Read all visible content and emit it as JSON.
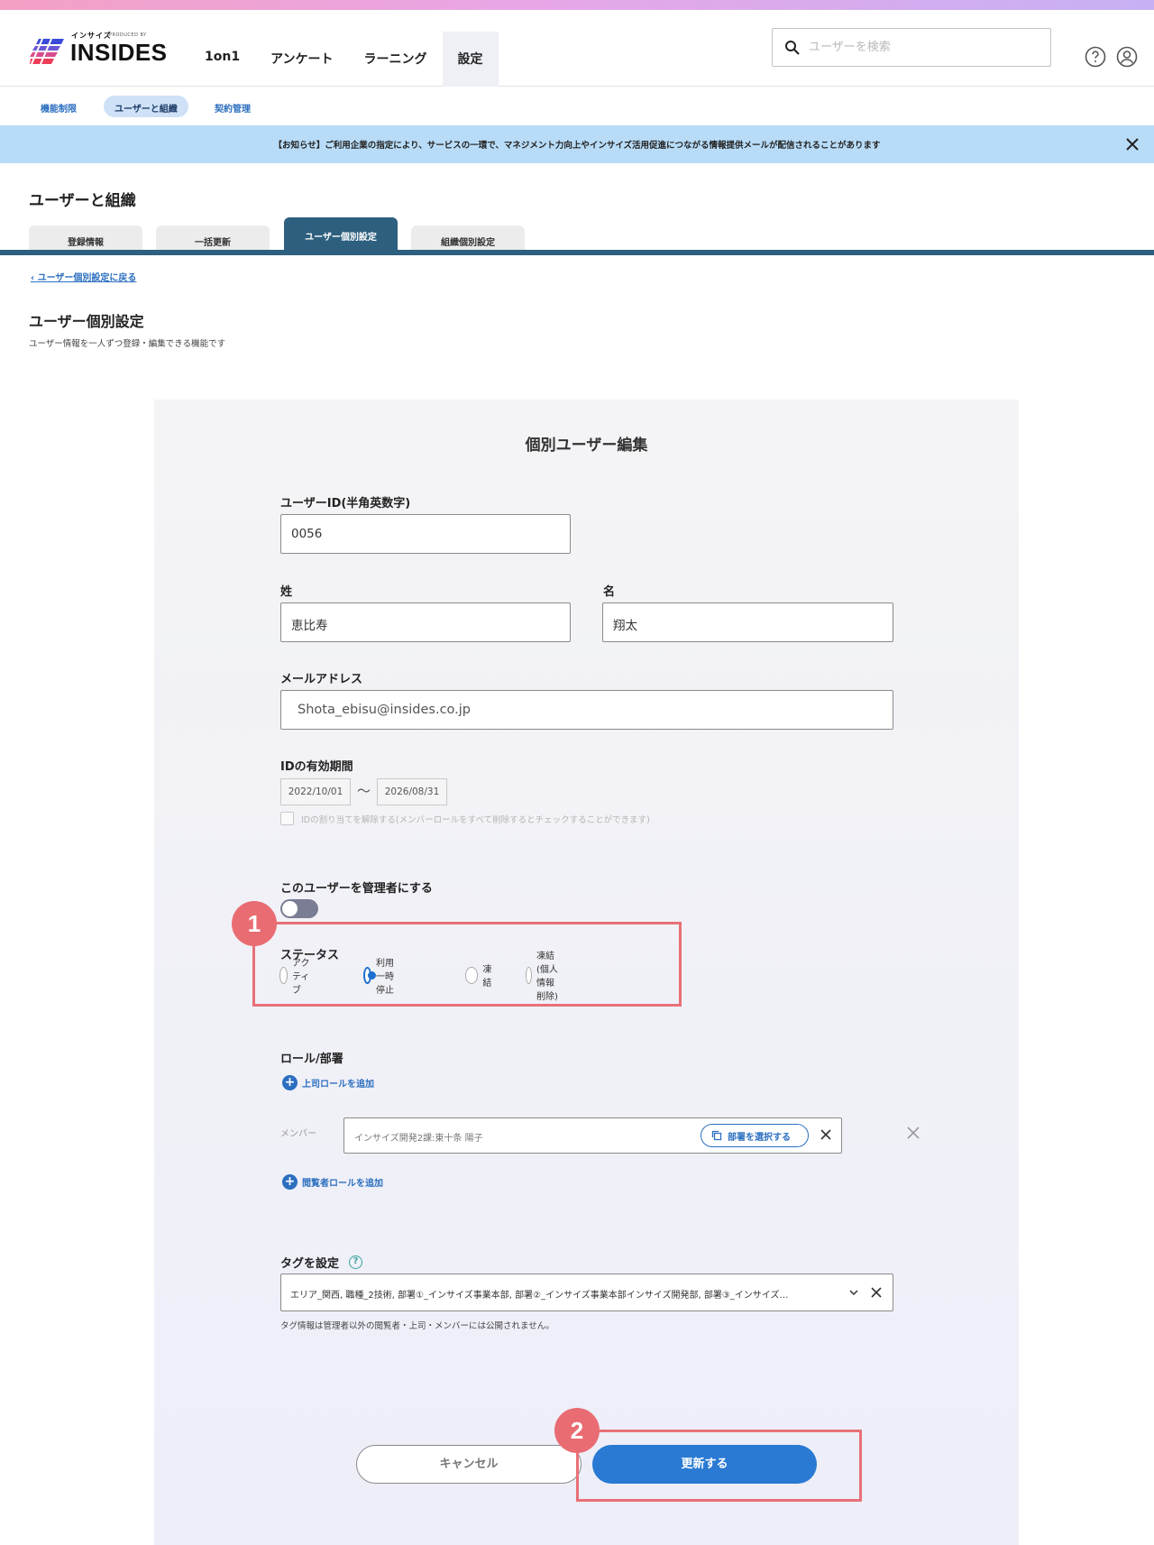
{
  "header": {
    "logo_small": "インサイズ",
    "logo_small2": "PRODUCED BY",
    "logo_text": "INSIDES",
    "nav": [
      "1on1",
      "アンケート",
      "ラーニング",
      "設定"
    ],
    "search_placeholder": "ユーザーを検索"
  },
  "subnav": [
    "機能制限",
    "ユーザーと組織",
    "契約管理"
  ],
  "notice": "【お知らせ】ご利用企業の指定により、サービスの一環で、マネジメント力向上やインサイズ活用促進につながる情報提供メールが配信されることがあります",
  "page_heading": "ユーザーと組織",
  "tabs": [
    "登録情報",
    "一括更新",
    "ユーザー個別設定",
    "組織個別設定"
  ],
  "back_link": "ユーザー個別設定に戻る",
  "section": {
    "title": "ユーザー個別設定",
    "desc": "ユーザー情報を一人ずつ登録・編集できる機能です"
  },
  "form": {
    "title": "個別ユーザー編集",
    "user_id_label": "ユーザーID(半角英数字)",
    "user_id": "0056",
    "last_name_label": "姓",
    "last_name": "恵比寿",
    "first_name_label": "名",
    "first_name": "翔太",
    "email_label": "メールアドレス",
    "email": "Shota_ebisu@insides.co.jp",
    "validity_label": "IDの有効期間",
    "date_from": "2022/10/01",
    "tilde": "〜",
    "date_to": "2026/08/31",
    "unassign_label": "IDの割り当てを解除する(メンバーロールをすべて削除するとチェックすることができます)",
    "admin_label": "このユーザーを管理者にする",
    "status_label": "ステータス",
    "status_options": [
      "アクティブ",
      "利用一時停止",
      "凍結",
      "凍結(個人情報削除)"
    ],
    "status_selected": "利用一時停止",
    "role_label": "ロール/部署",
    "add_boss_role": "上司ロールを追加",
    "member_label": "メンバー",
    "member_value": "インサイズ開発2課:東十条 陽子",
    "select_dept_button": "部署を選択する",
    "add_viewer_role": "閲覧者ロールを追加",
    "tag_label": "タグを設定",
    "tag_help": "?",
    "tag_value": "エリア_関西, 職種_2技術, 部署①_インサイズ事業本部, 部署②_インサイズ事業本部インサイズ開発部, 部署③_インサイズ…",
    "tag_note": "タグ情報は管理者以外の閲覧者・上司・メンバーには公開されません。",
    "cancel_button": "キャンセル",
    "update_button": "更新する"
  },
  "annotations": {
    "badge1": "1",
    "badge2": "2",
    "color": "#e97078"
  },
  "colors": {
    "primary": "#2a7ad3",
    "tab_active": "#2d5f7f",
    "notice_bg": "#b8dcf8"
  }
}
